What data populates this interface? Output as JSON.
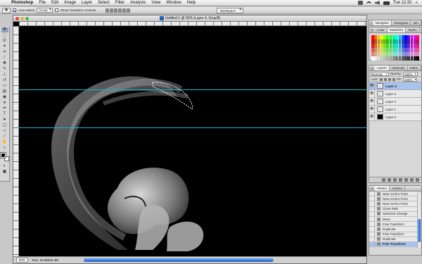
{
  "menubar": {
    "app": "Photoshop",
    "items": [
      "File",
      "Edit",
      "Image",
      "Layer",
      "Select",
      "Filter",
      "Analysis",
      "View",
      "Window",
      "Help"
    ],
    "clock": "Tue 12:32"
  },
  "options_bar": {
    "auto_select_label": "Auto-Select",
    "auto_select_checked": true,
    "auto_select_mode": "Group",
    "show_transform_label": "Show Transform Controls",
    "workspace_label": "Workspace"
  },
  "document": {
    "title": "Untitled-1 @ 50% (Layer 4, Gray/8)",
    "zoom": "50%",
    "doc_info": "Doc: 15.0M/16.4M"
  },
  "panels": {
    "nav_tabs": [
      "Navigator",
      "Histogram",
      "Info"
    ],
    "color_tabs": [
      "Color",
      "Swatches",
      "Styles"
    ],
    "layers_tabs": [
      "Layers",
      "Channels",
      "Paths"
    ],
    "blend_mode": "Normal",
    "opacity_label": "Opacity:",
    "opacity_value": "100%",
    "lock_label": "Lock:",
    "fill_label": "Fill:",
    "fill_value": "100%",
    "layers": [
      {
        "name": "Layer 4",
        "selected": true
      },
      {
        "name": "Layer 3",
        "selected": false
      },
      {
        "name": "Layer 2",
        "selected": false
      },
      {
        "name": "Layer 1",
        "selected": false
      },
      {
        "name": "Layer 0",
        "selected": false
      }
    ],
    "history_tabs": [
      "History",
      "Actions"
    ],
    "history": [
      {
        "name": "New Anchor Point",
        "selected": false
      },
      {
        "name": "New Anchor Point",
        "selected": false
      },
      {
        "name": "New Anchor Point",
        "selected": false
      },
      {
        "name": "Close Path",
        "selected": false
      },
      {
        "name": "Selection Change",
        "selected": false
      },
      {
        "name": "Move",
        "selected": false
      },
      {
        "name": "Free Transform",
        "selected": false
      },
      {
        "name": "Duplicate",
        "selected": false
      },
      {
        "name": "Free Transform",
        "selected": false
      },
      {
        "name": "Duplicate",
        "selected": false
      },
      {
        "name": "Free Transform",
        "selected": true
      }
    ]
  },
  "colors": {
    "guide": "#17b6d4",
    "selection_blue": "#a9c3ef",
    "canvas": "#000000"
  }
}
